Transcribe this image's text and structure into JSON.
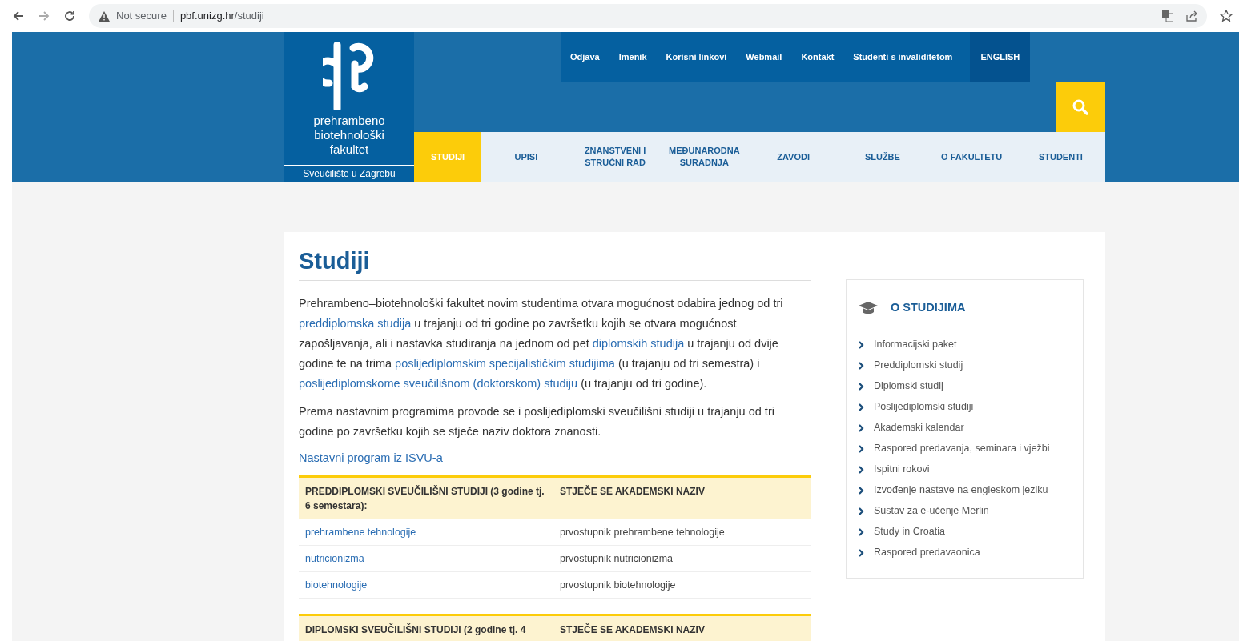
{
  "browser": {
    "security": "Not secure",
    "url_host": "pbf.unizg.hr",
    "url_path": "/studiji"
  },
  "logo": {
    "lines": [
      "prehrambeno",
      "biotehnološki",
      "fakultet"
    ],
    "university": "Sveučilište u Zagrebu"
  },
  "top_links": [
    {
      "label": "Odjava",
      "highlight": false
    },
    {
      "label": "Imenik",
      "highlight": false
    },
    {
      "label": "Korisni linkovi",
      "highlight": false
    },
    {
      "label": "Webmail",
      "highlight": false
    },
    {
      "label": "Kontakt",
      "highlight": false
    },
    {
      "label": "Studenti s invaliditetom",
      "highlight": false
    },
    {
      "label": "ENGLISH",
      "highlight": true
    }
  ],
  "nav": [
    {
      "label": "STUDIJI",
      "selected": true
    },
    {
      "label": "UPISI",
      "selected": false
    },
    {
      "label": "ZNANSTVENI I STRUČNI RAD",
      "selected": false
    },
    {
      "label": "MEĐUNARODNA SURADNJA",
      "selected": false
    },
    {
      "label": "ZAVODI",
      "selected": false
    },
    {
      "label": "SLUŽBE",
      "selected": false
    },
    {
      "label": "O FAKULTETU",
      "selected": false
    },
    {
      "label": "STUDENTI",
      "selected": false
    }
  ],
  "page_title": "Studiji",
  "paragraphs": [
    [
      {
        "text": "Prehrambeno–biotehnološki fakultet novim studentima otvara mogućnost odabira jednog od tri ",
        "link": false
      },
      {
        "text": "preddiplomska studija",
        "link": true
      },
      {
        "text": " u trajanju od tri godine po završetku kojih se otvara mogućnost zapošljavanja, ali i nastavka studiranja na jednom od pet ",
        "link": false
      },
      {
        "text": "diplomskih studija",
        "link": true
      },
      {
        "text": " u trajanju od dvije godine te na trima ",
        "link": false
      },
      {
        "text": "poslijediplomskim specijalističkim studijima",
        "link": true
      },
      {
        "text": " (u trajanju od tri semestra) i ",
        "link": false
      },
      {
        "text": "poslijediplomskome sveučilišnom (doktorskom) studiju",
        "link": true
      },
      {
        "text": " (u trajanju od tri godine).",
        "link": false
      }
    ],
    [
      {
        "text": "Prema nastavnim programima provode se i poslijediplomski sveučilišni studiji u trajanju od tri godine po završetku kojih se stječe naziv doktora znanosti.",
        "link": false
      }
    ]
  ],
  "program_link": "Nastavni program iz ISVU-a",
  "tables": [
    {
      "columns": [
        "PREDDIPLOMSKI SVEUČILIŠNI STUDIJI (3 godine tj. 6 semestara):",
        "STJEČE SE AKADEMSKI NAZIV"
      ],
      "rows": [
        {
          "program": "prehrambene tehnologije",
          "degree": "prvostupnik prehrambene tehnologije"
        },
        {
          "program": "nutricionizma",
          "degree": "prvostupnik nutricionizma"
        },
        {
          "program": "biotehnologije",
          "degree": "prvostupnik biotehnologije"
        }
      ]
    },
    {
      "columns": [
        "DIPLOMSKI SVEUČILIŠNI STUDIJI (2 godine tj. 4",
        "STJEČE SE AKADEMSKI NAZIV"
      ]
    }
  ],
  "sidebar": {
    "title": "O STUDIJIMA",
    "items": [
      "Informacijski paket",
      "Preddiplomski studij",
      "Diplomski studij",
      "Poslijediplomski studiji",
      "Akademski kalendar",
      "Raspored predavanja, seminara i vježbi",
      "Ispitni rokovi",
      "Izvođenje nastave na engleskom jeziku",
      "Sustav za e-učenje Merlin",
      "Study in Croatia",
      "Raspored predavaonica"
    ]
  }
}
